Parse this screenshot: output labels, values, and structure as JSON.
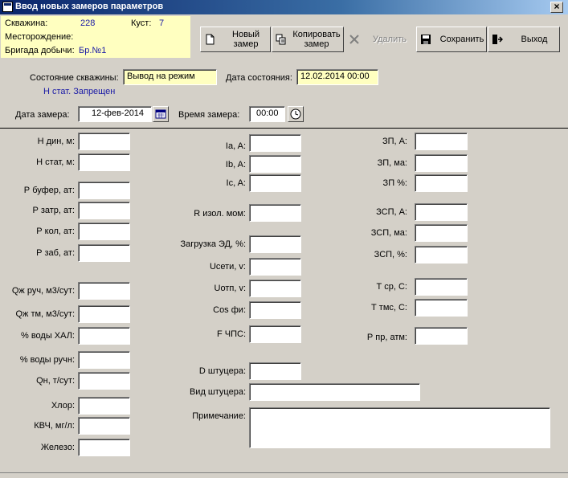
{
  "window": {
    "title": "Ввод новых замеров параметров",
    "close_glyph": "×"
  },
  "info": {
    "well_label": "Скважина:",
    "well_value": "228",
    "pad_label": "Куст:",
    "pad_value": "7",
    "field_label": "Месторождение:",
    "brigade_label": "Бригада добычи:",
    "brigade_value": "Бр.№1",
    "bg_color": "#ffffc0"
  },
  "toolbar": {
    "new_label": "Новый замер",
    "copy_label": "Копировать замер",
    "delete_label": "Удалить",
    "save_label": "Сохранить",
    "exit_label": "Выход"
  },
  "state": {
    "well_state_label": "Состояние скважины:",
    "well_state_value": "Вывод на режим",
    "state_date_label": "Дата состояния:",
    "state_date_value": "12.02.2014  00:00",
    "status_note": "Н стат. Запрещен"
  },
  "measure": {
    "date_label": "Дата замера:",
    "date_value": "12-фев-2014",
    "time_label": "Время замера:",
    "time_value": "00:00"
  },
  "col1": {
    "n_din": "Н дин, м:",
    "n_stat": "Н стат, м:",
    "p_bufer": "Р буфер, ат:",
    "p_zatr": "Р затр, ат:",
    "p_kol": "Р кол, ат:",
    "p_zab": "Р заб, ат:",
    "qzh_ruch": "Qж руч, м3/сут:",
    "qzh_tm": "Qж тм, м3/сут:",
    "voda_hal": "% воды ХАЛ:",
    "voda_ruch": "% воды ручн:",
    "qn": "Qн, т/сут:",
    "hlor": "Хлор:",
    "kvch": "КВЧ, мг/л:",
    "zhelezo": "Железо:"
  },
  "col2": {
    "ia": "Ia, A:",
    "ib": "Ib, A:",
    "ic": "Ic, A:",
    "r_izol": "R изол. мом:",
    "zagruzka": "Загрузка ЭД, %:",
    "useti": "Uсети, v:",
    "uotp": "Uотп, v:",
    "cos": "Cos фи:",
    "f_chps": "F ЧПС:",
    "d_shtucera": "D штуцера:",
    "vid_shtucera": "Вид штуцера:",
    "primechanie": "Примечание:"
  },
  "col3": {
    "zp_a": "ЗП, А:",
    "zp_ma": "ЗП, ма:",
    "zp_pct": "ЗП %:",
    "zsp_a": "ЗСП, А:",
    "zsp_ma": "ЗСП, ма:",
    "zsp_pct": "ЗСП, %:",
    "t_sr": "Т ср, С:",
    "t_tms": "Т тмс, С:",
    "p_pr": "Р пр, атм:"
  }
}
